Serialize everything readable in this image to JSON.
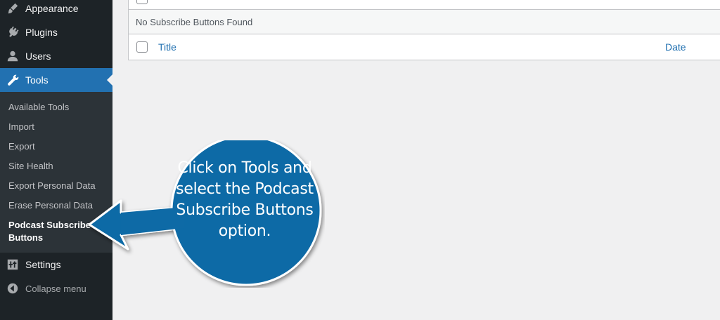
{
  "sidebar": {
    "items": [
      {
        "label": "Appearance",
        "icon": "paintbrush-icon"
      },
      {
        "label": "Plugins",
        "icon": "plug-icon"
      },
      {
        "label": "Users",
        "icon": "user-icon"
      },
      {
        "label": "Tools",
        "icon": "wrench-icon"
      },
      {
        "label": "Settings",
        "icon": "settings-sliders-icon"
      }
    ],
    "tools_submenu": [
      "Available Tools",
      "Import",
      "Export",
      "Site Health",
      "Export Personal Data",
      "Erase Personal Data",
      "Podcast Subscribe Buttons"
    ],
    "collapse_label": "Collapse menu"
  },
  "table": {
    "empty_message": "No Subscribe Buttons Found",
    "columns": [
      "Title",
      "Date"
    ]
  },
  "callout": {
    "text": "Click on Tools and select the Podcast Subscribe Buttons option."
  },
  "colors": {
    "sidebar_bg": "#1d2327",
    "submenu_bg": "#2c3338",
    "accent": "#2271b1",
    "callout_fill": "#0e6aa6"
  }
}
